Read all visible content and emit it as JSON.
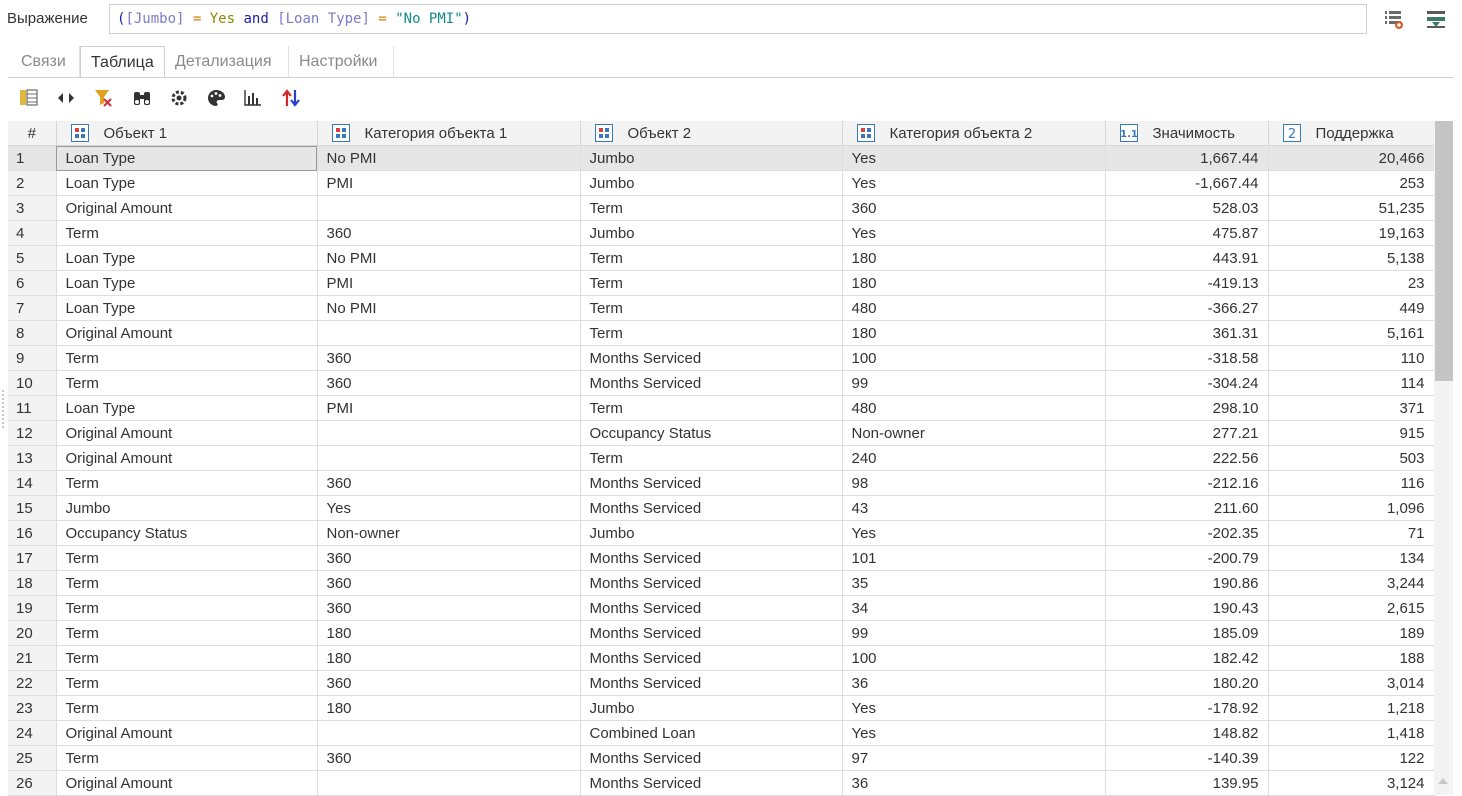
{
  "expression": {
    "label": "Выражение",
    "tokens": [
      "(",
      "[Jumbo]",
      " = ",
      "Yes",
      " and ",
      "[Loan Type]",
      " = ",
      "\"No PMI\"",
      ")"
    ]
  },
  "tabs": [
    {
      "label": "Связи",
      "active": false
    },
    {
      "label": "Таблица",
      "active": true
    },
    {
      "label": "Детализация",
      "active": false
    },
    {
      "label": "Настройки",
      "active": false
    }
  ],
  "toolbar_icons": [
    "columns-icon",
    "expand-columns-icon",
    "filter-clear-icon",
    "binoculars-search-icon",
    "settings-icon",
    "palette-icon",
    "bar-chart-icon",
    "sort-icon"
  ],
  "table": {
    "columns": [
      {
        "label": "#",
        "icon": ""
      },
      {
        "label": "Объект 1",
        "icon": "category-icon"
      },
      {
        "label": "Категория объекта 1",
        "icon": "category-icon"
      },
      {
        "label": "Объект 2",
        "icon": "category-icon"
      },
      {
        "label": "Категория объекта 2",
        "icon": "category-icon"
      },
      {
        "label": "Значимость",
        "icon": "decimal-icon"
      },
      {
        "label": "Поддержка",
        "icon": "integer-icon"
      }
    ],
    "selected_row": 0,
    "rows": [
      [
        "1",
        "Loan Type",
        "No PMI",
        "Jumbo",
        "Yes",
        "1,667.44",
        "20,466"
      ],
      [
        "2",
        "Loan Type",
        "PMI",
        "Jumbo",
        "Yes",
        "-1,667.44",
        "253"
      ],
      [
        "3",
        "Original Amount",
        "",
        "Term",
        "360",
        "528.03",
        "51,235"
      ],
      [
        "4",
        "Term",
        "360",
        "Jumbo",
        "Yes",
        "475.87",
        "19,163"
      ],
      [
        "5",
        "Loan Type",
        "No PMI",
        "Term",
        "180",
        "443.91",
        "5,138"
      ],
      [
        "6",
        "Loan Type",
        "PMI",
        "Term",
        "180",
        "-419.13",
        "23"
      ],
      [
        "7",
        "Loan Type",
        "No PMI",
        "Term",
        "480",
        "-366.27",
        "449"
      ],
      [
        "8",
        "Original Amount",
        "",
        "Term",
        "180",
        "361.31",
        "5,161"
      ],
      [
        "9",
        "Term",
        "360",
        "Months Serviced",
        "100",
        "-318.58",
        "110"
      ],
      [
        "10",
        "Term",
        "360",
        "Months Serviced",
        "99",
        "-304.24",
        "114"
      ],
      [
        "11",
        "Loan Type",
        "PMI",
        "Term",
        "480",
        "298.10",
        "371"
      ],
      [
        "12",
        "Original Amount",
        "",
        "Occupancy Status",
        "Non-owner",
        "277.21",
        "915"
      ],
      [
        "13",
        "Original Amount",
        "",
        "Term",
        "240",
        "222.56",
        "503"
      ],
      [
        "14",
        "Term",
        "360",
        "Months Serviced",
        "98",
        "-212.16",
        "116"
      ],
      [
        "15",
        "Jumbo",
        "Yes",
        "Months Serviced",
        "43",
        "211.60",
        "1,096"
      ],
      [
        "16",
        "Occupancy Status",
        "Non-owner",
        "Jumbo",
        "Yes",
        "-202.35",
        "71"
      ],
      [
        "17",
        "Term",
        "360",
        "Months Serviced",
        "101",
        "-200.79",
        "134"
      ],
      [
        "18",
        "Term",
        "360",
        "Months Serviced",
        "35",
        "190.86",
        "3,244"
      ],
      [
        "19",
        "Term",
        "360",
        "Months Serviced",
        "34",
        "190.43",
        "2,615"
      ],
      [
        "20",
        "Term",
        "180",
        "Months Serviced",
        "99",
        "185.09",
        "189"
      ],
      [
        "21",
        "Term",
        "180",
        "Months Serviced",
        "100",
        "182.42",
        "188"
      ],
      [
        "22",
        "Term",
        "360",
        "Months Serviced",
        "36",
        "180.20",
        "3,014"
      ],
      [
        "23",
        "Term",
        "180",
        "Jumbo",
        "Yes",
        "-178.92",
        "1,218"
      ],
      [
        "24",
        "Original Amount",
        "",
        "Combined Loan",
        "Yes",
        "148.82",
        "1,418"
      ],
      [
        "25",
        "Term",
        "360",
        "Months Serviced",
        "97",
        "-140.39",
        "122"
      ],
      [
        "26",
        "Original Amount",
        "",
        "Months Serviced",
        "36",
        "139.95",
        "3,124"
      ]
    ]
  },
  "colors": {
    "selected_row": "#e6e6e6",
    "header_bg": "#f3f3f3",
    "icon_blue": "#3a78b8"
  }
}
